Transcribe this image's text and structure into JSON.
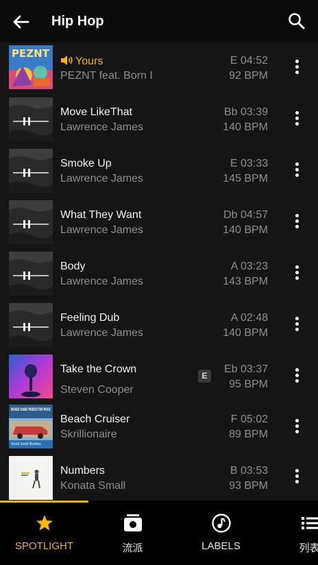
{
  "header": {
    "title": "Hip Hop"
  },
  "tracks": [
    {
      "name": "Yours",
      "artist": "PEZNT feat. Born I",
      "key_time": "E 04:52",
      "bpm": "92 BPM",
      "playing": true
    },
    {
      "name": "Move LikeThat",
      "artist": "Lawrence James",
      "key_time": "Bb 03:39",
      "bpm": "140 BPM"
    },
    {
      "name": "Smoke Up",
      "artist": "Lawrence James",
      "key_time": "E 03:33",
      "bpm": "145 BPM"
    },
    {
      "name": "What They Want",
      "artist": "Lawrence James",
      "key_time": "Db 04:57",
      "bpm": "140 BPM"
    },
    {
      "name": "Body",
      "artist": "Lawrence James",
      "key_time": "A 03:23",
      "bpm": "143 BPM"
    },
    {
      "name": "Feeling Dub",
      "artist": "Lawrence James",
      "key_time": "A 02:48",
      "bpm": "140 BPM"
    },
    {
      "name": "Take the Crown",
      "artist": "Steven Cooper",
      "key_time": "Eb 03:37",
      "bpm": "95 BPM",
      "explicit": "E"
    },
    {
      "name": "Beach Cruiser",
      "artist": "Skrillionaire",
      "key_time": "F 05:02",
      "bpm": "89 BPM"
    },
    {
      "name": "Numbers",
      "artist": "Konata Small",
      "key_time": "B 03:53",
      "bpm": "93 BPM"
    }
  ],
  "artwork_text": {
    "yours": "PEZNT",
    "beach_cruiser": "BOOGIE SHADE PRODUCTION MUSIC",
    "beach_cruiser_sub": "Solid Gold Bodies"
  },
  "tabs": [
    {
      "label": "SPOTLIGHT",
      "icon": "star-icon",
      "active": true
    },
    {
      "label": "流派",
      "icon": "genre-icon"
    },
    {
      "label": "LABELS",
      "icon": "music-note-icon"
    },
    {
      "label": "列表",
      "icon": "list-icon"
    }
  ],
  "colors": {
    "accent": "#f4b400",
    "background": "#151515",
    "header": "#0b0b0b",
    "secondary_text": "#8e8e8e"
  }
}
